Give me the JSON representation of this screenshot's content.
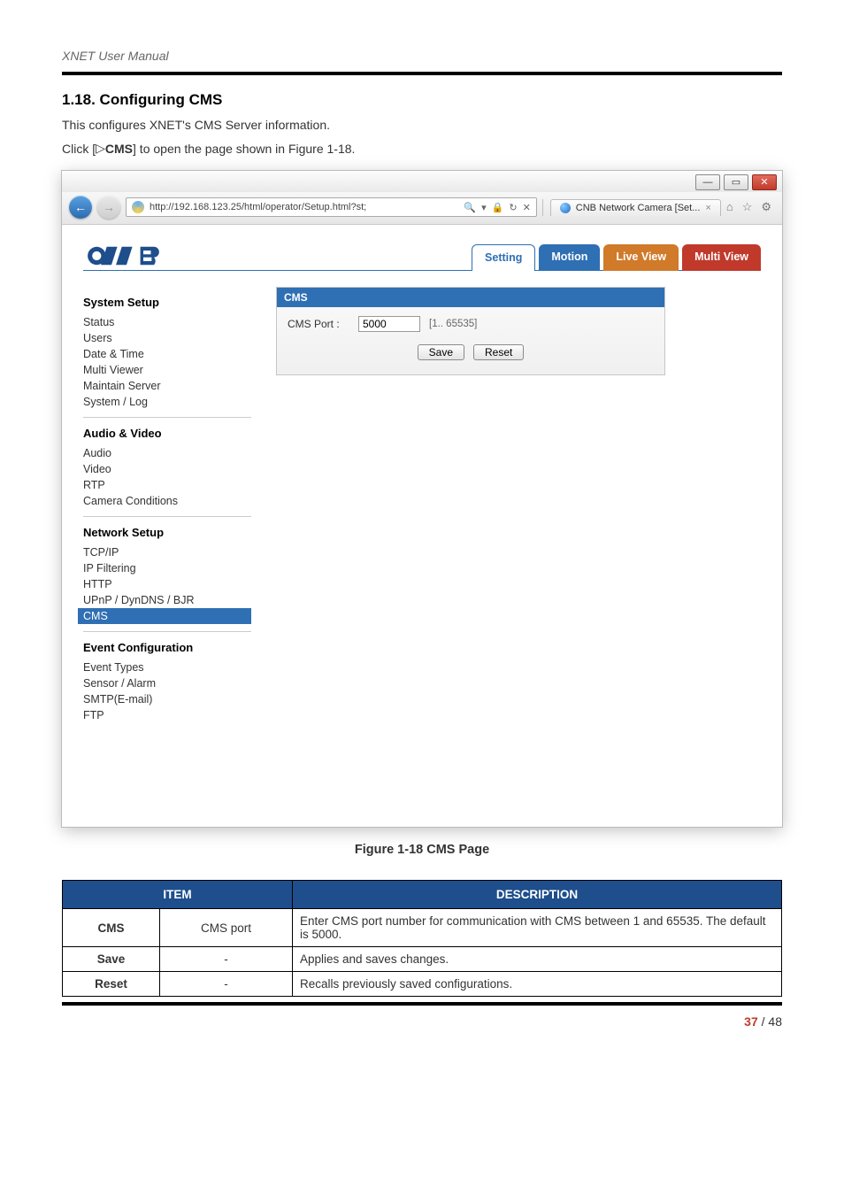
{
  "doc": {
    "manual_header": "XNET User Manual",
    "section_number": "1.18.",
    "section_title": "Configuring CMS",
    "intro_line1": "This configures XNET's CMS Server information.",
    "intro_line2_pre": "Click [",
    "intro_line2_cmd": "CMS",
    "intro_line2_post": "] to open the page shown in Figure 1-18.",
    "figure_caption": "Figure 1-18 CMS Page",
    "page_current": "37",
    "page_sep": " / ",
    "page_total": "48"
  },
  "browser": {
    "win_min": "—",
    "win_max": "▭",
    "win_close": "✕",
    "nav_back": "←",
    "nav_fwd": "→",
    "url": "http://192.168.123.25/html/operator/Setup.html?st;",
    "url_tail_icons": [
      "🔍",
      "▾",
      "🔒",
      "↻",
      "✕"
    ],
    "tab_label": "CNB Network Camera [Set...",
    "tab_close": "×",
    "tool_home": "⌂",
    "tool_star": "☆",
    "tool_gear": "⚙"
  },
  "app": {
    "logo_text": "CNB",
    "tabs": {
      "setting": "Setting",
      "motion": "Motion",
      "liveview": "Live View",
      "multiview": "Multi View"
    },
    "sidebar": {
      "g1_title": "System Setup",
      "g1_items": [
        "Status",
        "Users",
        "Date & Time",
        "Multi Viewer",
        "Maintain Server",
        "System / Log"
      ],
      "g2_title": "Audio & Video",
      "g2_items": [
        "Audio",
        "Video",
        "RTP",
        "Camera Conditions"
      ],
      "g3_title": "Network Setup",
      "g3_items": [
        "TCP/IP",
        "IP Filtering",
        "HTTP",
        "UPnP / DynDNS / BJR",
        "CMS"
      ],
      "g3_active_index": 4,
      "g4_title": "Event Configuration",
      "g4_items": [
        "Event Types",
        "Sensor / Alarm",
        "SMTP(E-mail)",
        "FTP"
      ]
    },
    "panel": {
      "title": "CMS",
      "port_label": "CMS Port :",
      "port_value": "5000",
      "port_range": "[1.. 65535]",
      "save": "Save",
      "reset": "Reset"
    }
  },
  "table": {
    "h_item": "ITEM",
    "h_desc": "DESCRIPTION",
    "rows": [
      {
        "item": "CMS",
        "sub": "CMS port",
        "desc": "Enter CMS port number for communication with CMS between 1 and 65535. The default is 5000."
      },
      {
        "item": "Save",
        "sub": "-",
        "desc": "Applies and saves changes."
      },
      {
        "item": "Reset",
        "sub": "-",
        "desc": "Recalls previously saved configurations."
      }
    ]
  }
}
